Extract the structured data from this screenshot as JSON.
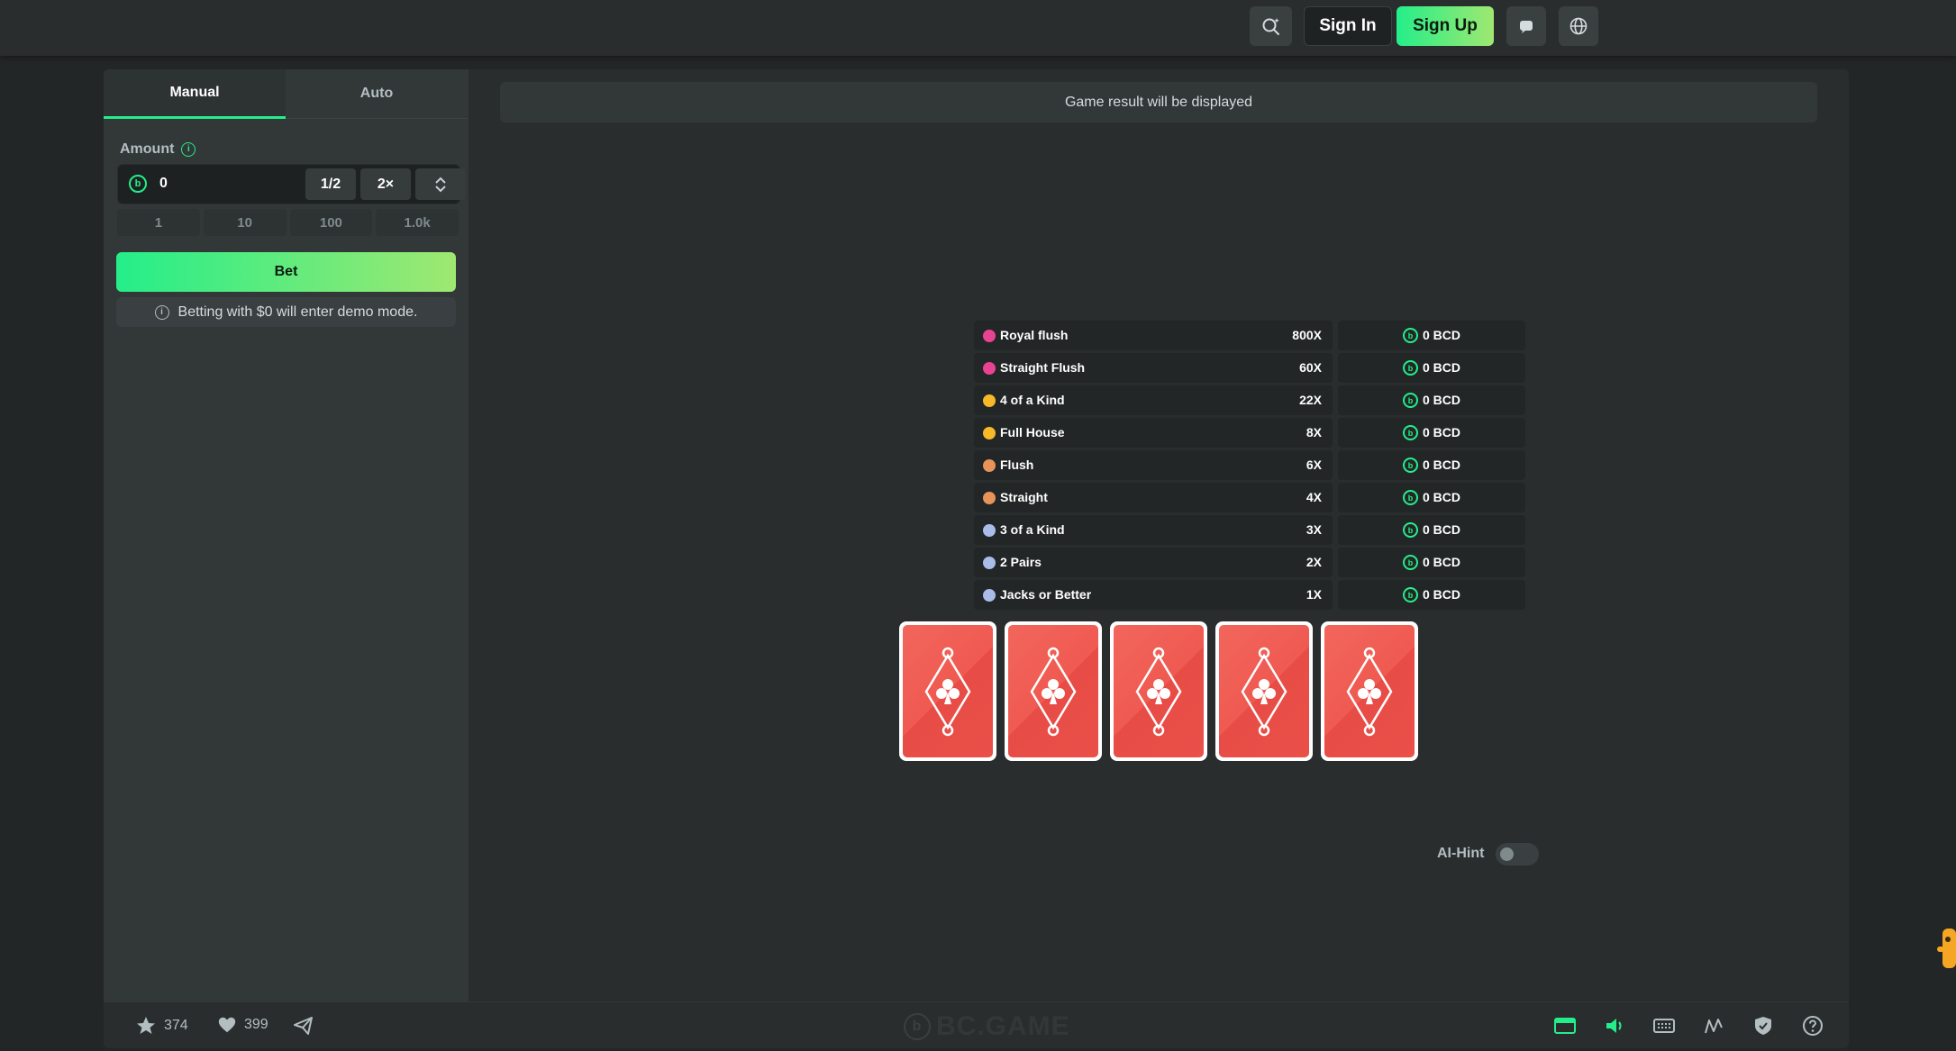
{
  "header": {
    "signin_label": "Sign In",
    "signup_label": "Sign Up"
  },
  "sidebar": {
    "tabs": [
      {
        "label": "Manual",
        "active": true
      },
      {
        "label": "Auto",
        "active": false
      }
    ],
    "amount_label": "Amount",
    "amount_value": "0",
    "half_label": "1/2",
    "double_label": "2×",
    "presets": [
      "1",
      "10",
      "100",
      "1.0k"
    ],
    "bet_label": "Bet",
    "demo_note": "Betting with $0 will enter demo mode."
  },
  "game": {
    "result_text": "Game result will be displayed",
    "paytable": [
      {
        "name": "Royal flush",
        "multiplier": "800X",
        "amount": "0 BCD",
        "color": "#e84393"
      },
      {
        "name": "Straight Flush",
        "multiplier": "60X",
        "amount": "0 BCD",
        "color": "#e84393"
      },
      {
        "name": "4 of a Kind",
        "multiplier": "22X",
        "amount": "0 BCD",
        "color": "#f7b928"
      },
      {
        "name": "Full House",
        "multiplier": "8X",
        "amount": "0 BCD",
        "color": "#f7b928"
      },
      {
        "name": "Flush",
        "multiplier": "6X",
        "amount": "0 BCD",
        "color": "#e8935a"
      },
      {
        "name": "Straight",
        "multiplier": "4X",
        "amount": "0 BCD",
        "color": "#e8935a"
      },
      {
        "name": "3 of a Kind",
        "multiplier": "3X",
        "amount": "0 BCD",
        "color": "#a9bde8"
      },
      {
        "name": "2 Pairs",
        "multiplier": "2X",
        "amount": "0 BCD",
        "color": "#a9bde8"
      },
      {
        "name": "Jacks or Better",
        "multiplier": "1X",
        "amount": "0 BCD",
        "color": "#a9bde8"
      }
    ],
    "card_count": 5,
    "ai_hint_label": "AI-Hint",
    "ai_hint_on": false
  },
  "footer": {
    "favorites_count": "374",
    "likes_count": "399",
    "brand": "BC.GAME"
  },
  "colors": {
    "accent": "#24ee89",
    "card_red": "#ef5a51"
  }
}
